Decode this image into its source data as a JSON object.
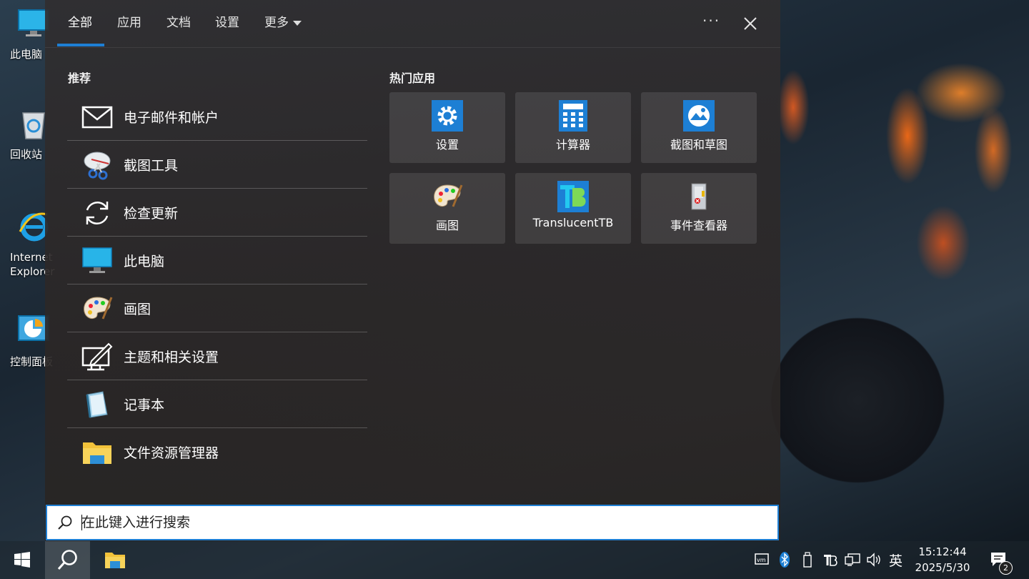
{
  "desktop": {
    "icons": [
      {
        "label": "此电脑",
        "icon": "monitor-icon"
      },
      {
        "label": "回收站",
        "icon": "recycle-bin-icon"
      },
      {
        "label": "Internet Explorer",
        "icon": "internet-explorer-icon"
      },
      {
        "label": "控制面板",
        "icon": "control-panel-icon"
      }
    ]
  },
  "panel": {
    "tabs": [
      "全部",
      "应用",
      "文档",
      "设置",
      "更多"
    ],
    "active_tab": "全部",
    "more_dots": "···",
    "recommended_title": "推荐",
    "recommended": [
      {
        "label": "电子邮件和帐户",
        "icon": "mail-icon"
      },
      {
        "label": "截图工具",
        "icon": "snipping-tool-icon"
      },
      {
        "label": "检查更新",
        "icon": "refresh-icon"
      },
      {
        "label": "此电脑",
        "icon": "monitor-icon"
      },
      {
        "label": "画图",
        "icon": "paint-palette-icon"
      },
      {
        "label": "主题和相关设置",
        "icon": "theme-edit-icon"
      },
      {
        "label": "记事本",
        "icon": "notepad-icon"
      },
      {
        "label": "文件资源管理器",
        "icon": "folder-icon"
      }
    ],
    "top_apps_title": "热门应用",
    "top_apps": [
      {
        "label": "设置",
        "icon": "gear-icon"
      },
      {
        "label": "计算器",
        "icon": "calculator-icon"
      },
      {
        "label": "截图和草图",
        "icon": "snip-sketch-icon"
      },
      {
        "label": "画图",
        "icon": "paint-palette-icon"
      },
      {
        "label": "TranslucentTB",
        "icon": "translucenttb-icon"
      },
      {
        "label": "事件查看器",
        "icon": "event-viewer-icon"
      }
    ]
  },
  "search": {
    "placeholder": "在此键入进行搜索",
    "value": ""
  },
  "taskbar": {
    "tray": {
      "ime": "英"
    },
    "clock": {
      "time": "15:12:44",
      "date": "2025/5/30"
    },
    "notification_count": "2"
  },
  "colors": {
    "accent": "#1e7fd4"
  }
}
